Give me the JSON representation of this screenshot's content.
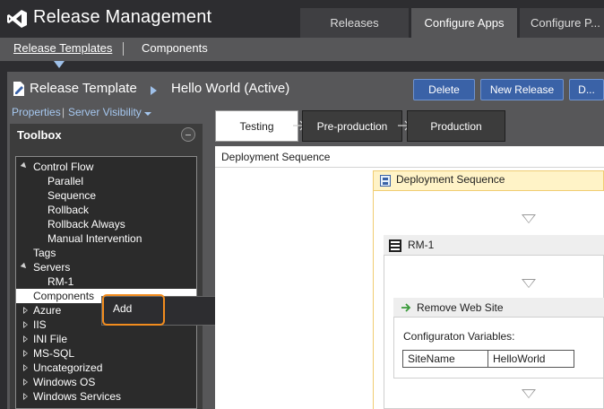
{
  "app": {
    "title": "Release Management",
    "top_tabs": [
      {
        "label": "Releases"
      },
      {
        "label": "Configure Apps"
      },
      {
        "label": "Configure P..."
      }
    ]
  },
  "subnav": {
    "items": [
      {
        "label": "Release Templates"
      },
      {
        "label": "Components"
      }
    ]
  },
  "header": {
    "title": "Release Template",
    "name": "Hello World (Active)",
    "buttons": [
      {
        "label": "Delete"
      },
      {
        "label": "New Release"
      },
      {
        "label": "D..."
      }
    ]
  },
  "links": {
    "properties": "Properties",
    "separator": "|",
    "server_visibility": "Server Visibility"
  },
  "toolbox": {
    "title": "Toolbox",
    "items": [
      {
        "label": "Control Flow"
      },
      {
        "label": "Parallel"
      },
      {
        "label": "Sequence"
      },
      {
        "label": "Rollback"
      },
      {
        "label": "Rollback Always"
      },
      {
        "label": "Manual Intervention"
      },
      {
        "label": "Tags"
      },
      {
        "label": "Servers"
      },
      {
        "label": "RM-1"
      },
      {
        "label": "Components"
      },
      {
        "label": "Azure"
      },
      {
        "label": "IIS"
      },
      {
        "label": "INI File"
      },
      {
        "label": "MS-SQL"
      },
      {
        "label": "Uncategorized"
      },
      {
        "label": "Windows OS"
      },
      {
        "label": "Windows Services"
      }
    ]
  },
  "context_menu": {
    "items": [
      {
        "label": "Add"
      }
    ]
  },
  "stages": [
    {
      "label": "Testing"
    },
    {
      "label": "Pre-production"
    },
    {
      "label": "Production"
    }
  ],
  "canvas": {
    "header": "Deployment Sequence",
    "sequence_label": "Deployment Sequence",
    "server": "RM-1",
    "action": "Remove Web Site",
    "config_label": "Configuraton Variables:",
    "variables": [
      {
        "name": "SiteName",
        "value": "HelloWorld"
      }
    ]
  },
  "colors": {
    "accent": "#3a62a7",
    "highlight": "#f28c1e",
    "sequence_bg": "#fff3c7"
  }
}
